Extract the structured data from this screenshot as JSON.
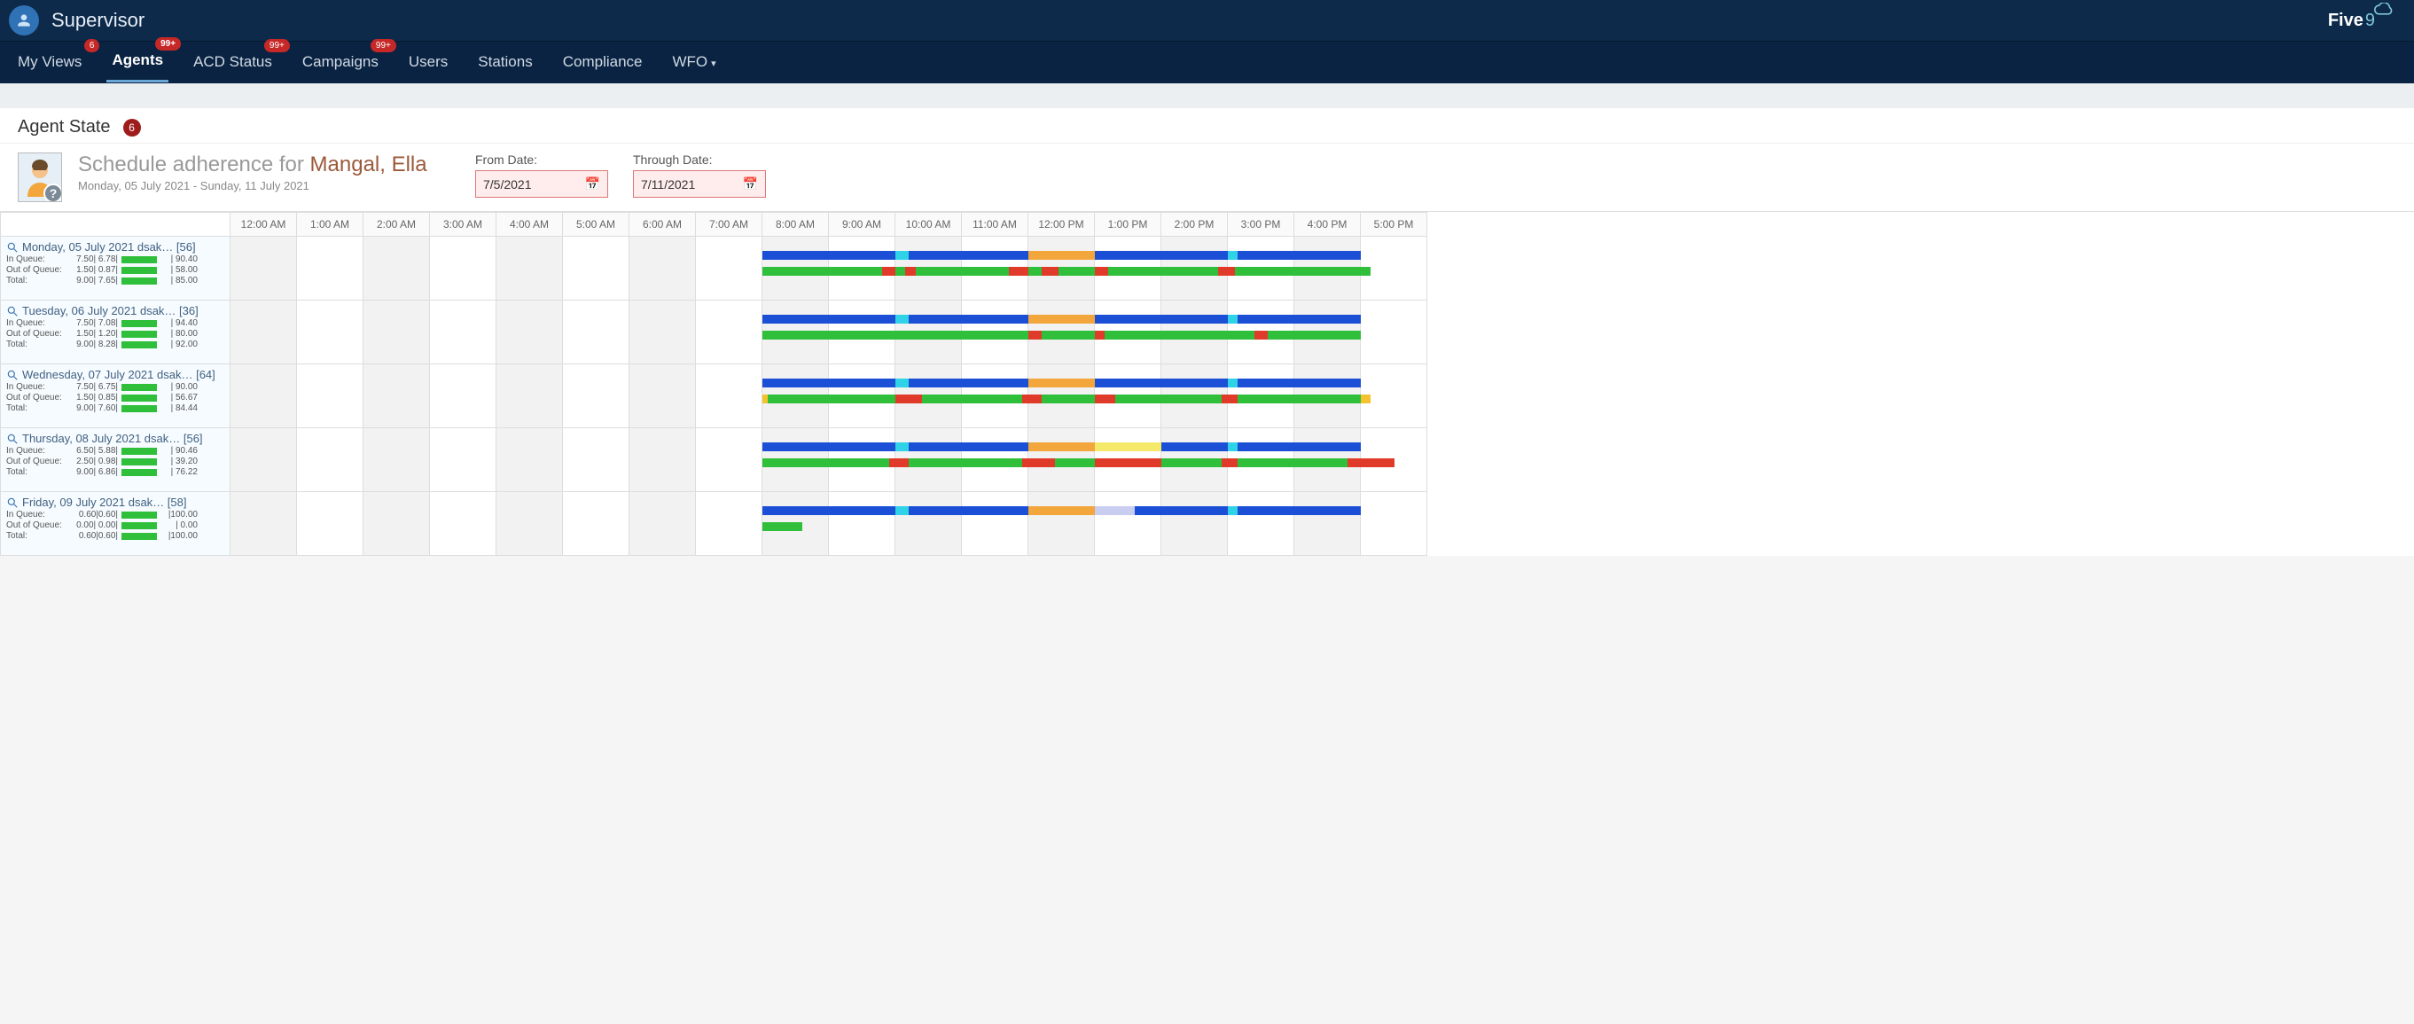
{
  "header": {
    "app_title": "Supervisor",
    "brand_main": "Five",
    "brand_nine": "9"
  },
  "nav": {
    "items": [
      {
        "label": "My Views",
        "badge": "6"
      },
      {
        "label": "Agents",
        "badge": "99+",
        "active": true
      },
      {
        "label": "ACD Status",
        "badge": "99+"
      },
      {
        "label": "Campaigns",
        "badge": "99+"
      },
      {
        "label": "Users"
      },
      {
        "label": "Stations"
      },
      {
        "label": "Compliance"
      },
      {
        "label": "WFO",
        "caret": true
      }
    ]
  },
  "section": {
    "title": "Agent State",
    "count": "6"
  },
  "adherence": {
    "prefix": "Schedule adherence for",
    "agent_name": "Mangal, Ella",
    "subtitle": "Monday, 05 July 2021 - Sunday, 11 July 2021",
    "from_label": "From Date:",
    "from_value": "7/5/2021",
    "through_label": "Through Date:",
    "through_value": "7/11/2021"
  },
  "timeline": {
    "hours": [
      "12:00 AM",
      "1:00 AM",
      "2:00 AM",
      "3:00 AM",
      "4:00 AM",
      "5:00 AM",
      "6:00 AM",
      "7:00 AM",
      "8:00 AM",
      "9:00 AM",
      "10:00 AM",
      "11:00 AM",
      "12:00 PM",
      "1:00 PM",
      "2:00 PM",
      "3:00 PM",
      "4:00 PM",
      "5:00 PM"
    ],
    "days": [
      {
        "title": "Monday, 05 July 2021 dsak…  [56]",
        "stats": [
          {
            "lbl": "In Queue:",
            "nums": "7.50| 6.78|",
            "pct": "| 90.40"
          },
          {
            "lbl": "Out of Queue:",
            "nums": "1.50| 0.87|",
            "pct": "| 58.00"
          },
          {
            "lbl": "Total:",
            "nums": "9.00| 7.65|",
            "pct": "| 85.00"
          }
        ],
        "sched": [
          {
            "c": "c-blue",
            "s": 8.0,
            "e": 10.0
          },
          {
            "c": "c-cyan",
            "s": 10.0,
            "e": 10.2
          },
          {
            "c": "c-blue",
            "s": 10.2,
            "e": 12.0
          },
          {
            "c": "c-orange",
            "s": 12.0,
            "e": 13.0
          },
          {
            "c": "c-blue",
            "s": 13.0,
            "e": 15.0
          },
          {
            "c": "c-cyan",
            "s": 15.0,
            "e": 15.15
          },
          {
            "c": "c-blue",
            "s": 15.15,
            "e": 17.0
          }
        ],
        "actual": [
          {
            "c": "c-green",
            "s": 8.0,
            "e": 9.8
          },
          {
            "c": "c-red",
            "s": 9.8,
            "e": 10.0
          },
          {
            "c": "c-green",
            "s": 10.0,
            "e": 10.15
          },
          {
            "c": "c-red",
            "s": 10.15,
            "e": 10.3
          },
          {
            "c": "c-green",
            "s": 10.3,
            "e": 11.7
          },
          {
            "c": "c-red",
            "s": 11.7,
            "e": 12.0
          },
          {
            "c": "c-green",
            "s": 12.0,
            "e": 12.2
          },
          {
            "c": "c-red",
            "s": 12.2,
            "e": 12.45
          },
          {
            "c": "c-green",
            "s": 12.45,
            "e": 13.0
          },
          {
            "c": "c-red",
            "s": 13.0,
            "e": 13.2
          },
          {
            "c": "c-green",
            "s": 13.2,
            "e": 14.85
          },
          {
            "c": "c-red",
            "s": 14.85,
            "e": 15.1
          },
          {
            "c": "c-green",
            "s": 15.1,
            "e": 17.15
          }
        ]
      },
      {
        "title": "Tuesday, 06 July 2021 dsak…  [36]",
        "stats": [
          {
            "lbl": "In Queue:",
            "nums": "7.50| 7.08|",
            "pct": "| 94.40"
          },
          {
            "lbl": "Out of Queue:",
            "nums": "1.50| 1.20|",
            "pct": "| 80.00"
          },
          {
            "lbl": "Total:",
            "nums": "9.00| 8.28|",
            "pct": "| 92.00"
          }
        ],
        "sched": [
          {
            "c": "c-blue",
            "s": 8.0,
            "e": 10.0
          },
          {
            "c": "c-cyan",
            "s": 10.0,
            "e": 10.2
          },
          {
            "c": "c-blue",
            "s": 10.2,
            "e": 12.0
          },
          {
            "c": "c-orange",
            "s": 12.0,
            "e": 13.0
          },
          {
            "c": "c-blue",
            "s": 13.0,
            "e": 15.0
          },
          {
            "c": "c-cyan",
            "s": 15.0,
            "e": 15.15
          },
          {
            "c": "c-blue",
            "s": 15.15,
            "e": 17.0
          }
        ],
        "actual": [
          {
            "c": "c-green",
            "s": 8.0,
            "e": 12.0
          },
          {
            "c": "c-red",
            "s": 12.0,
            "e": 12.2
          },
          {
            "c": "c-green",
            "s": 12.2,
            "e": 13.0
          },
          {
            "c": "c-red",
            "s": 13.0,
            "e": 13.15
          },
          {
            "c": "c-green",
            "s": 13.15,
            "e": 15.4
          },
          {
            "c": "c-red",
            "s": 15.4,
            "e": 15.6
          },
          {
            "c": "c-green",
            "s": 15.6,
            "e": 17.0
          }
        ]
      },
      {
        "title": "Wednesday, 07 July 2021 dsak…  [64]",
        "stats": [
          {
            "lbl": "In Queue:",
            "nums": "7.50| 6.75|",
            "pct": "| 90.00"
          },
          {
            "lbl": "Out of Queue:",
            "nums": "1.50| 0.85|",
            "pct": "| 56.67"
          },
          {
            "lbl": "Total:",
            "nums": "9.00| 7.60|",
            "pct": "| 84.44"
          }
        ],
        "sched": [
          {
            "c": "c-blue",
            "s": 8.0,
            "e": 10.0
          },
          {
            "c": "c-cyan",
            "s": 10.0,
            "e": 10.2
          },
          {
            "c": "c-blue",
            "s": 10.2,
            "e": 12.0
          },
          {
            "c": "c-orange",
            "s": 12.0,
            "e": 13.0
          },
          {
            "c": "c-blue",
            "s": 13.0,
            "e": 15.0
          },
          {
            "c": "c-cyan",
            "s": 15.0,
            "e": 15.15
          },
          {
            "c": "c-blue",
            "s": 15.15,
            "e": 17.0
          }
        ],
        "actual": [
          {
            "c": "c-amber",
            "s": 8.0,
            "e": 8.08
          },
          {
            "c": "c-green",
            "s": 8.08,
            "e": 10.0
          },
          {
            "c": "c-red",
            "s": 10.0,
            "e": 10.4
          },
          {
            "c": "c-green",
            "s": 10.4,
            "e": 11.9
          },
          {
            "c": "c-red",
            "s": 11.9,
            "e": 12.2
          },
          {
            "c": "c-green",
            "s": 12.2,
            "e": 13.0
          },
          {
            "c": "c-red",
            "s": 13.0,
            "e": 13.3
          },
          {
            "c": "c-green",
            "s": 13.3,
            "e": 14.9
          },
          {
            "c": "c-red",
            "s": 14.9,
            "e": 15.15
          },
          {
            "c": "c-green",
            "s": 15.15,
            "e": 17.0
          },
          {
            "c": "c-amber",
            "s": 17.0,
            "e": 17.15
          }
        ]
      },
      {
        "title": "Thursday, 08 July 2021 dsak…  [56]",
        "stats": [
          {
            "lbl": "In Queue:",
            "nums": "6.50| 5.88|",
            "pct": "| 90.46"
          },
          {
            "lbl": "Out of Queue:",
            "nums": "2.50| 0.98|",
            "pct": "| 39.20"
          },
          {
            "lbl": "Total:",
            "nums": "9.00| 6.86|",
            "pct": "| 76.22"
          }
        ],
        "sched": [
          {
            "c": "c-blue",
            "s": 8.0,
            "e": 10.0
          },
          {
            "c": "c-cyan",
            "s": 10.0,
            "e": 10.2
          },
          {
            "c": "c-blue",
            "s": 10.2,
            "e": 12.0
          },
          {
            "c": "c-orange",
            "s": 12.0,
            "e": 13.0
          },
          {
            "c": "c-yellow",
            "s": 13.0,
            "e": 14.0
          },
          {
            "c": "c-blue",
            "s": 14.0,
            "e": 15.0
          },
          {
            "c": "c-cyan",
            "s": 15.0,
            "e": 15.15
          },
          {
            "c": "c-blue",
            "s": 15.15,
            "e": 17.0
          }
        ],
        "actual": [
          {
            "c": "c-green",
            "s": 8.0,
            "e": 9.9
          },
          {
            "c": "c-red",
            "s": 9.9,
            "e": 10.2
          },
          {
            "c": "c-green",
            "s": 10.2,
            "e": 11.9
          },
          {
            "c": "c-red",
            "s": 11.9,
            "e": 12.4
          },
          {
            "c": "c-green",
            "s": 12.4,
            "e": 13.0
          },
          {
            "c": "c-red",
            "s": 13.0,
            "e": 14.0
          },
          {
            "c": "c-green",
            "s": 14.0,
            "e": 14.9
          },
          {
            "c": "c-red",
            "s": 14.9,
            "e": 15.15
          },
          {
            "c": "c-green",
            "s": 15.15,
            "e": 16.8
          },
          {
            "c": "c-red",
            "s": 16.8,
            "e": 17.5
          }
        ]
      },
      {
        "title": "Friday, 09 July 2021  dsak…  [58]",
        "stats": [
          {
            "lbl": "In Queue:",
            "nums": "0.60|0.60|",
            "pct": "|100.00"
          },
          {
            "lbl": "Out of Queue:",
            "nums": "0.00| 0.00|",
            "pct": "|  0.00"
          },
          {
            "lbl": "Total:",
            "nums": "0.60|0.60|",
            "pct": "|100.00"
          }
        ],
        "sched": [
          {
            "c": "c-blue",
            "s": 8.0,
            "e": 10.0
          },
          {
            "c": "c-cyan",
            "s": 10.0,
            "e": 10.2
          },
          {
            "c": "c-blue",
            "s": 10.2,
            "e": 12.0
          },
          {
            "c": "c-orange",
            "s": 12.0,
            "e": 13.0
          },
          {
            "c": "c-lav",
            "s": 13.0,
            "e": 13.6
          },
          {
            "c": "c-blue",
            "s": 13.6,
            "e": 15.0
          },
          {
            "c": "c-cyan",
            "s": 15.0,
            "e": 15.15
          },
          {
            "c": "c-blue",
            "s": 15.15,
            "e": 17.0
          }
        ],
        "actual": [
          {
            "c": "c-green",
            "s": 8.0,
            "e": 8.6
          }
        ]
      }
    ]
  }
}
